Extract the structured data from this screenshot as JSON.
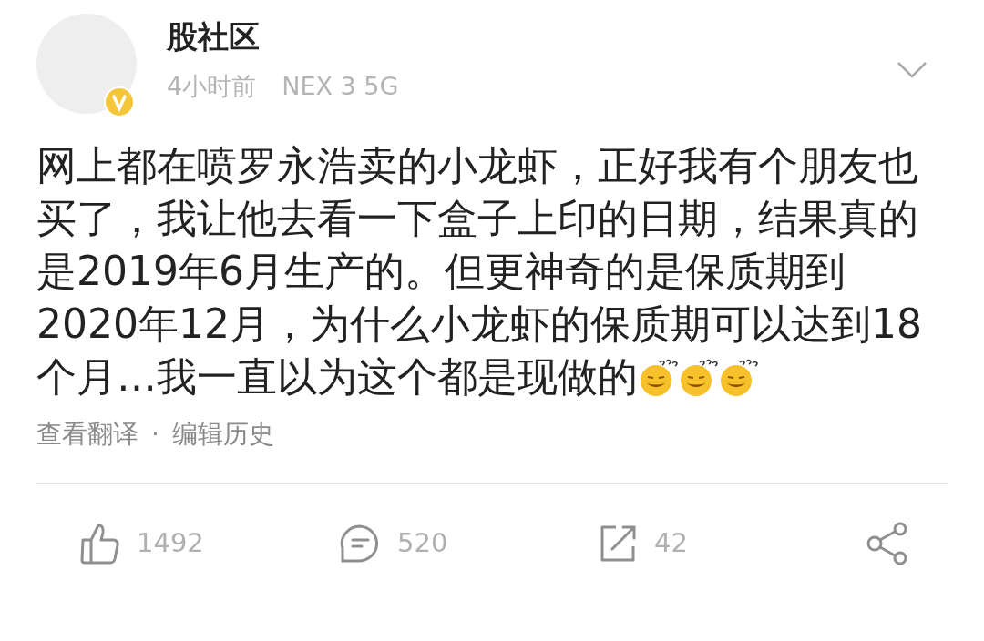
{
  "author": {
    "name": "股社区",
    "verified": true,
    "time": "4小时前",
    "device": "NEX 3 5G"
  },
  "post": {
    "lines": [
      "网上都在喷罗永浩卖的小龙虾，正好我有个朋友也",
      "买了，我让他去看一下盒子上印的日期，结果真的",
      "是2019年6月生产的。但更神奇的是保质期到",
      "2020年12月，为什么小龙虾的保质期可以达到18",
      "个月…我一直以为这个都是现做的"
    ],
    "emojis": [
      {
        "kind": "confused"
      },
      {
        "kind": "confused"
      },
      {
        "kind": "confused"
      }
    ]
  },
  "links": [
    "查看翻译",
    "·",
    "编辑历史"
  ],
  "actions": [
    {
      "kind": "like",
      "count": "1492"
    },
    {
      "kind": "comment",
      "count": "520"
    },
    {
      "kind": "repost",
      "count": "42"
    },
    {
      "kind": "share"
    }
  ]
}
